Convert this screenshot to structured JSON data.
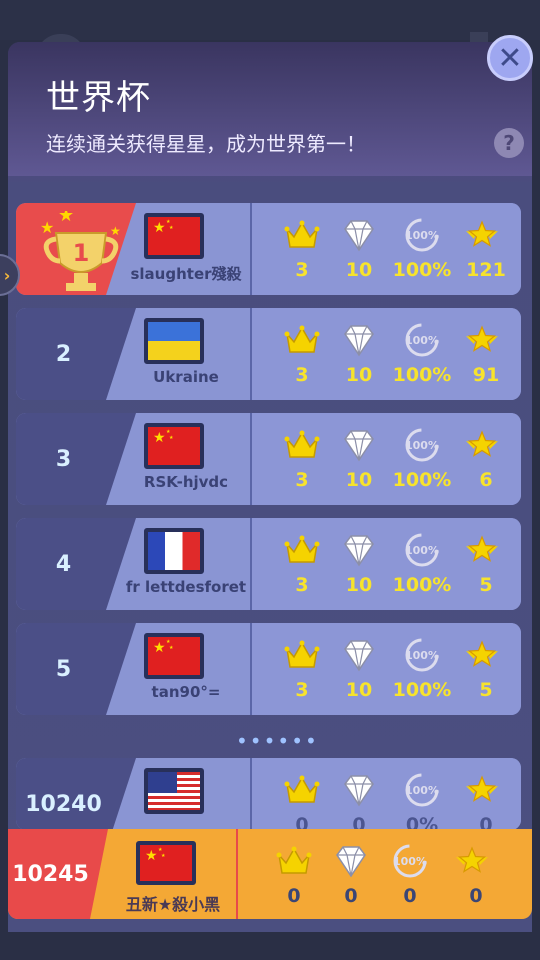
{
  "header": {
    "title": "世界杯",
    "subtitle": "连续通关获得星星，成为世界第一！",
    "help_label": "?",
    "close_label": "✕"
  },
  "rows": [
    {
      "rank": "1",
      "flag": "cn",
      "name": "slaughter殘殺",
      "crowns": "3",
      "diamonds": "10",
      "percent": "100%",
      "stars": "121"
    },
    {
      "rank": "2",
      "flag": "ua",
      "name": "Ukraine",
      "crowns": "3",
      "diamonds": "10",
      "percent": "100%",
      "stars": "91"
    },
    {
      "rank": "3",
      "flag": "cn",
      "name": "RSK-hjvdc",
      "crowns": "3",
      "diamonds": "10",
      "percent": "100%",
      "stars": "6"
    },
    {
      "rank": "4",
      "flag": "fr",
      "name": "fr lettdesforet",
      "crowns": "3",
      "diamonds": "10",
      "percent": "100%",
      "stars": "5"
    },
    {
      "rank": "5",
      "flag": "cn",
      "name": "tan90°=",
      "crowns": "3",
      "diamonds": "10",
      "percent": "100%",
      "stars": "5"
    },
    {
      "rank": "10240",
      "flag": "us",
      "name": "",
      "crowns": "0",
      "diamonds": "0",
      "percent": "0%",
      "stars": "0"
    }
  ],
  "separator": "••••••",
  "self": {
    "rank": "10245",
    "flag": "cn",
    "name": "丑新★殺小黑",
    "crowns": "0",
    "diamonds": "0",
    "percent": "0",
    "stars": "0"
  },
  "icons": [
    "crown-icon",
    "diamond-icon",
    "percent-badge-icon",
    "winged-star-icon",
    "trophy-icon",
    "close-icon",
    "help-icon",
    "chevron-right-icon"
  ],
  "colors": {
    "gold": "#f7e32c",
    "first_place": "#e84c4c",
    "self_row": "#f4a835",
    "row_bg": "#8c96d6"
  }
}
